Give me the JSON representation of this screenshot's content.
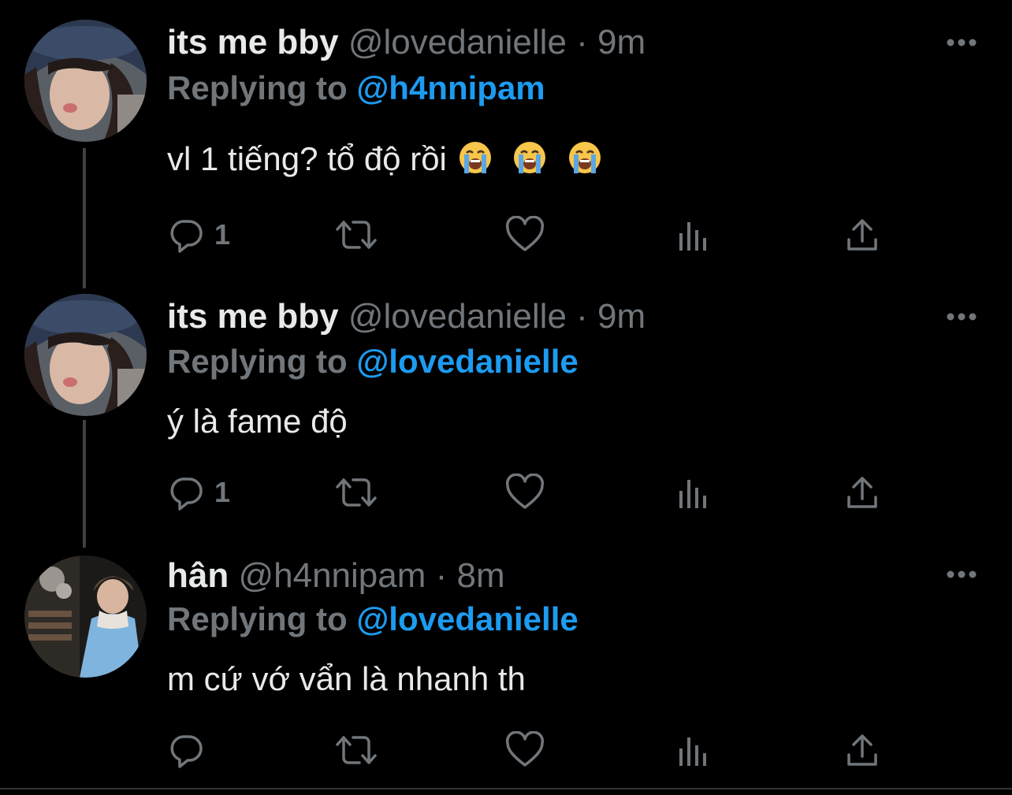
{
  "tweets": [
    {
      "name": "its me bby",
      "handle": "@lovedanielle",
      "separator": "·",
      "time": "9m",
      "replying_prefix": "Replying to ",
      "replying_to": "@h4nnipam",
      "text": "vl 1 tiếng? tổ độ rồi",
      "emojis": [
        "loudly-crying-face-emoji",
        "loudly-crying-face-emoji",
        "loudly-crying-face-emoji"
      ],
      "reply_count": "1"
    },
    {
      "name": "its me bby",
      "handle": "@lovedanielle",
      "separator": "·",
      "time": "9m",
      "replying_prefix": "Replying to ",
      "replying_to": "@lovedanielle",
      "text": "ý là fame độ",
      "reply_count": "1"
    },
    {
      "name": "hân",
      "handle": "@h4nnipam",
      "separator": "·",
      "time": "8m",
      "replying_prefix": "Replying to ",
      "replying_to": "@lovedanielle",
      "text": "m cứ vớ vẩn là nhanh th",
      "reply_count": ""
    }
  ],
  "icons": {
    "more": "more-horizontal-icon",
    "reply": "reply-bubble-icon",
    "retweet": "retweet-icon",
    "like": "heart-icon",
    "analytics": "analytics-bars-icon",
    "share": "share-upload-icon"
  },
  "colors": {
    "background": "#000000",
    "primary_text": "#e7e9ea",
    "secondary_text": "#71767b",
    "accent": "#1d9bf0",
    "thread_line": "#3e4144"
  }
}
